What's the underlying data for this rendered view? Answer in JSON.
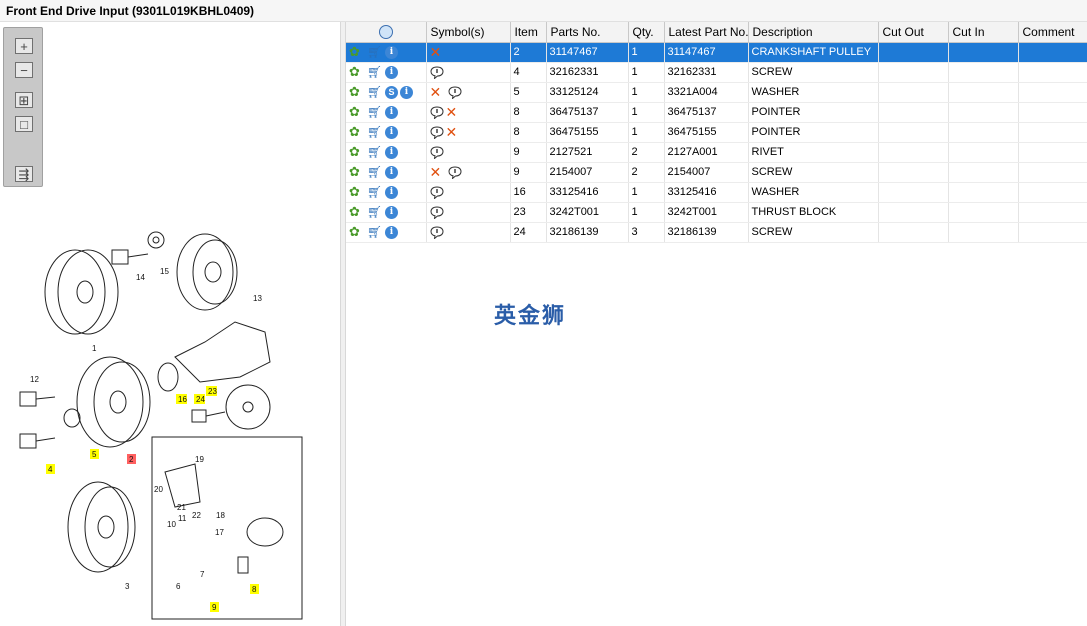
{
  "window": {
    "title": "Front End Drive Input (9301L019KBHL0409)"
  },
  "zoom_toolbar": {
    "zoom_in": "+",
    "zoom_out": "−",
    "fit": "⊞",
    "actual": "□",
    "export": "⇶"
  },
  "table": {
    "headers": [
      "",
      "Symbol(s)",
      "Item",
      "Parts No.",
      "Qty.",
      "Latest Part No.",
      "Description",
      "Cut Out",
      "Cut In",
      "Comment"
    ],
    "rows": [
      {
        "item": "2",
        "parts_no": "31147467",
        "qty": "1",
        "latest": "31147467",
        "desc": "CRANKSHAFT PULLEY",
        "cut_out": "",
        "cut_in": "",
        "comment": ""
      },
      {
        "item": "4",
        "parts_no": "32162331",
        "qty": "1",
        "latest": "32162331",
        "desc": "SCREW",
        "cut_out": "",
        "cut_in": "",
        "comment": ""
      },
      {
        "item": "5",
        "parts_no": "33125124",
        "qty": "1",
        "latest": "3321A004",
        "desc": "WASHER",
        "cut_out": "",
        "cut_in": "",
        "comment": ""
      },
      {
        "item": "8",
        "parts_no": "36475137",
        "qty": "1",
        "latest": "36475137",
        "desc": "POINTER",
        "cut_out": "",
        "cut_in": "",
        "comment": ""
      },
      {
        "item": "8",
        "parts_no": "36475155",
        "qty": "1",
        "latest": "36475155",
        "desc": "POINTER",
        "cut_out": "",
        "cut_in": "",
        "comment": ""
      },
      {
        "item": "9",
        "parts_no": "2127521",
        "qty": "2",
        "latest": "2127A001",
        "desc": "RIVET",
        "cut_out": "",
        "cut_in": "",
        "comment": ""
      },
      {
        "item": "9",
        "parts_no": "2154007",
        "qty": "2",
        "latest": "2154007",
        "desc": "SCREW",
        "cut_out": "",
        "cut_in": "",
        "comment": ""
      },
      {
        "item": "16",
        "parts_no": "33125416",
        "qty": "1",
        "latest": "33125416",
        "desc": "WASHER",
        "cut_out": "",
        "cut_in": "",
        "comment": ""
      },
      {
        "item": "23",
        "parts_no": "3242T001",
        "qty": "1",
        "latest": "3242T001",
        "desc": "THRUST BLOCK",
        "cut_out": "",
        "cut_in": "",
        "comment": ""
      },
      {
        "item": "24",
        "parts_no": "32186139",
        "qty": "3",
        "latest": "32186139",
        "desc": "SCREW",
        "cut_out": "",
        "cut_in": "",
        "comment": ""
      }
    ],
    "info_letter": "i",
    "s_badge": "S"
  },
  "watermark": "英金狮",
  "diagram": {
    "callouts": [
      "15",
      "14",
      "13",
      "1",
      "12",
      "16",
      "24",
      "23",
      "5",
      "4",
      "2",
      "19",
      "20",
      "21",
      "18",
      "11",
      "22",
      "17",
      "10",
      "7",
      "6",
      "8",
      "9",
      "3"
    ]
  },
  "colors": {
    "selection": "#1e7ad6",
    "highlight_yellow": "#ffff00",
    "highlight_red": "#ff6060",
    "watermark": "#2a5da8"
  }
}
